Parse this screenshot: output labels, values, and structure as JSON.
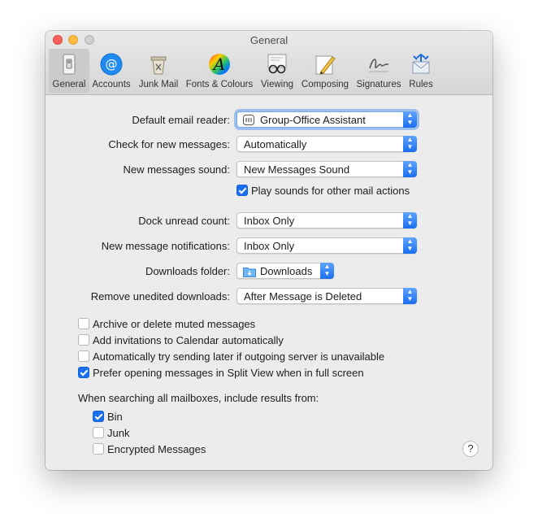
{
  "window": {
    "title": "General"
  },
  "toolbar": {
    "tabs": [
      {
        "label": "General",
        "icon": "switch-icon",
        "active": true
      },
      {
        "label": "Accounts",
        "icon": "at-icon"
      },
      {
        "label": "Junk Mail",
        "icon": "trash-icon"
      },
      {
        "label": "Fonts & Colours",
        "icon": "color-wheel-icon"
      },
      {
        "label": "Viewing",
        "icon": "glasses-icon"
      },
      {
        "label": "Composing",
        "icon": "pencil-icon"
      },
      {
        "label": "Signatures",
        "icon": "signature-icon"
      },
      {
        "label": "Rules",
        "icon": "rules-icon"
      }
    ]
  },
  "settings": {
    "default_reader": {
      "label": "Default email reader:",
      "value": "Group-Office Assistant"
    },
    "check_messages": {
      "label": "Check for new messages:",
      "value": "Automatically"
    },
    "messages_sound": {
      "label": "New messages sound:",
      "value": "New Messages Sound"
    },
    "play_sounds": {
      "label": "Play sounds for other mail actions",
      "checked": true
    },
    "dock_unread": {
      "label": "Dock unread count:",
      "value": "Inbox Only"
    },
    "notifications": {
      "label": "New message notifications:",
      "value": "Inbox Only"
    },
    "downloads_folder": {
      "label": "Downloads folder:",
      "value": "Downloads"
    },
    "remove_downloads": {
      "label": "Remove unedited downloads:",
      "value": "After Message is Deleted"
    }
  },
  "options": [
    {
      "label": "Archive or delete muted messages",
      "checked": false
    },
    {
      "label": "Add invitations to Calendar automatically",
      "checked": false
    },
    {
      "label": "Automatically try sending later if outgoing server is unavailable",
      "checked": false
    },
    {
      "label": "Prefer opening messages in Split View when in full screen",
      "checked": true
    }
  ],
  "search": {
    "heading": "When searching all mailboxes, include results from:",
    "items": [
      {
        "label": "Bin",
        "checked": true
      },
      {
        "label": "Junk",
        "checked": false
      },
      {
        "label": "Encrypted Messages",
        "checked": false
      }
    ]
  },
  "help": {
    "label": "?"
  }
}
